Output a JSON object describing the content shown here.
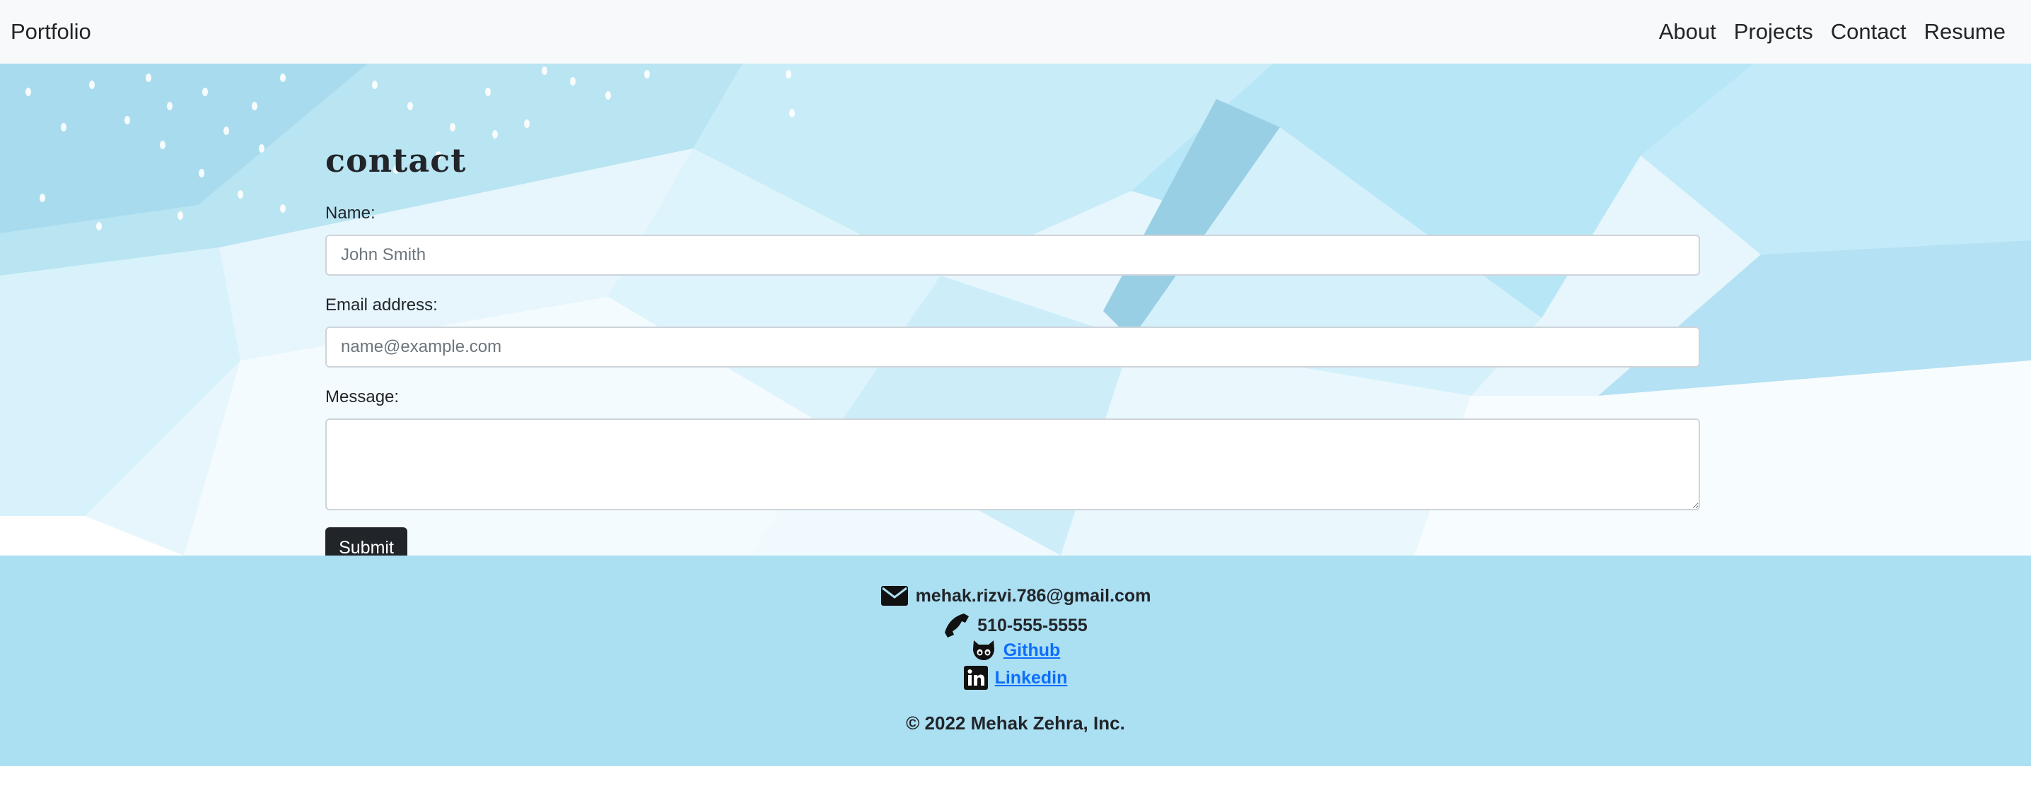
{
  "navbar": {
    "brand": "Portfolio",
    "links": [
      "About",
      "Projects",
      "Contact",
      "Resume"
    ]
  },
  "contact_form": {
    "title": "contact",
    "name_label": "Name:",
    "name_placeholder": "John Smith",
    "email_label": "Email address:",
    "email_placeholder": "name@example.com",
    "message_label": "Message:",
    "message_value": "",
    "submit_label": "Submit"
  },
  "footer": {
    "email": "mehak.rizvi.786@gmail.com",
    "phone": "510-555-5555",
    "github_label": "Github",
    "linkedin_label": "Linkedin",
    "copyright": "© 2022 Mehak Zehra, Inc.",
    "icons": [
      "envelope-icon",
      "phone-icon",
      "github-icon",
      "linkedin-icon"
    ]
  },
  "colors": {
    "navbar_bg": "#f8f9fa",
    "footer_bg": "#abdff2",
    "button_bg": "#212529",
    "link": "#0d6efd"
  }
}
